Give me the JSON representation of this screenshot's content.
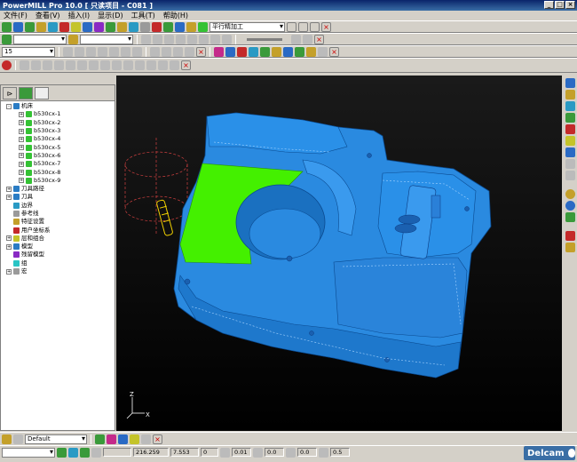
{
  "window": {
    "title": "PowerMILL Pro 10.0    [ 只读项目 - C081 ]",
    "minimize": "_",
    "maximize": "□",
    "close": "×"
  },
  "menu": [
    "文件(F)",
    "查看(V)",
    "插入(I)",
    "显示(D)",
    "工具(T)",
    "帮助(H)"
  ],
  "toolbar1": {
    "strategy": "平行精加工"
  },
  "toolbar3": {
    "combo_value": "15"
  },
  "explorer": {
    "tree": [
      {
        "label": "机床",
        "expand": "-",
        "icon": "#2a7cc4",
        "indent": 0
      },
      {
        "label": "b530cx-1",
        "expand": "+",
        "icon": "#34c234",
        "indent": 1
      },
      {
        "label": "b530cx-2",
        "expand": "+",
        "icon": "#34c234",
        "indent": 1
      },
      {
        "label": "b530cx-3",
        "expand": "+",
        "icon": "#34c234",
        "indent": 1
      },
      {
        "label": "b530cx-4",
        "expand": "+",
        "icon": "#34c234",
        "indent": 1
      },
      {
        "label": "b530cx-5",
        "expand": "+",
        "icon": "#34c234",
        "indent": 1
      },
      {
        "label": "b530cx-6",
        "expand": "+",
        "icon": "#34c234",
        "indent": 1
      },
      {
        "label": "b530cx-7",
        "expand": "+",
        "icon": "#34c234",
        "indent": 1
      },
      {
        "label": "b530cx-8",
        "expand": "+",
        "icon": "#34c234",
        "indent": 1
      },
      {
        "label": "b530cx-9",
        "expand": "+",
        "icon": "#34c234",
        "indent": 1
      },
      {
        "label": "刀具路径",
        "expand": "+",
        "icon": "#2a7cc4",
        "indent": 0
      },
      {
        "label": "刀具",
        "expand": "+",
        "icon": "#2a7cc4",
        "indent": 0
      },
      {
        "label": "边界",
        "expand": "",
        "icon": "#2a9ac4",
        "indent": 0
      },
      {
        "label": "参考线",
        "expand": "",
        "icon": "#9a9a9a",
        "indent": 0
      },
      {
        "label": "特征设置",
        "expand": "",
        "icon": "#c4a02a",
        "indent": 0
      },
      {
        "label": "用户坐标系",
        "expand": "",
        "icon": "#c42a2a",
        "indent": 0
      },
      {
        "label": "层和组合",
        "expand": "+",
        "icon": "#c4c42a",
        "indent": 0
      },
      {
        "label": "模型",
        "expand": "+",
        "icon": "#2a7cc4",
        "indent": 0
      },
      {
        "label": "残留模型",
        "expand": "",
        "icon": "#8a2ac4",
        "indent": 0
      },
      {
        "label": "组",
        "expand": "",
        "icon": "#2ac4c4",
        "indent": 0
      },
      {
        "label": "宏",
        "expand": "+",
        "icon": "#9a9a9a",
        "indent": 0
      }
    ]
  },
  "viewport": {
    "axis_x": "X",
    "axis_z": "Z",
    "colors": {
      "part": "#2a8ae0",
      "selected_face": "#44f000",
      "background": "#000000"
    }
  },
  "status": {
    "combo_value": "Default",
    "coord_x": "216.259",
    "coord_y": "7.553",
    "coord_z": "0",
    "tolerance": "0.01",
    "stock": "0.0",
    "thickness": "0.0",
    "step": "0.5"
  },
  "brand": "Delcam"
}
